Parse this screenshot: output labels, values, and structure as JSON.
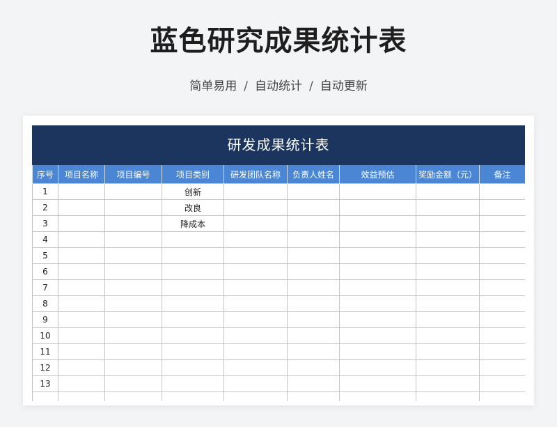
{
  "header": {
    "title": "蓝色研究成果统计表",
    "subtitle_parts": [
      "简单易用",
      "自动统计",
      "自动更新"
    ],
    "separator": "/"
  },
  "sheet": {
    "title": "研发成果统计表",
    "columns": [
      "序号",
      "项目名称",
      "项目编号",
      "项目类别",
      "研发团队名称",
      "负责人姓名",
      "效益预估",
      "奖励金额（元）",
      "备注"
    ],
    "rows": [
      [
        "1",
        "",
        "",
        "创新",
        "",
        "",
        "",
        "",
        ""
      ],
      [
        "2",
        "",
        "",
        "改良",
        "",
        "",
        "",
        "",
        ""
      ],
      [
        "3",
        "",
        "",
        "降成本",
        "",
        "",
        "",
        "",
        ""
      ],
      [
        "4",
        "",
        "",
        "",
        "",
        "",
        "",
        "",
        ""
      ],
      [
        "5",
        "",
        "",
        "",
        "",
        "",
        "",
        "",
        ""
      ],
      [
        "6",
        "",
        "",
        "",
        "",
        "",
        "",
        "",
        ""
      ],
      [
        "7",
        "",
        "",
        "",
        "",
        "",
        "",
        "",
        ""
      ],
      [
        "8",
        "",
        "",
        "",
        "",
        "",
        "",
        "",
        ""
      ],
      [
        "9",
        "",
        "",
        "",
        "",
        "",
        "",
        "",
        ""
      ],
      [
        "10",
        "",
        "",
        "",
        "",
        "",
        "",
        "",
        ""
      ],
      [
        "11",
        "",
        "",
        "",
        "",
        "",
        "",
        "",
        ""
      ],
      [
        "12",
        "",
        "",
        "",
        "",
        "",
        "",
        "",
        ""
      ],
      [
        "13",
        "",
        "",
        "",
        "",
        "",
        "",
        "",
        ""
      ],
      [
        "",
        "",
        "",
        "",
        "",
        "",
        "",
        "",
        ""
      ]
    ]
  },
  "colors": {
    "title_bar": "#1b355e",
    "header_row": "#4a86d4",
    "background": "#f3f4f6"
  }
}
